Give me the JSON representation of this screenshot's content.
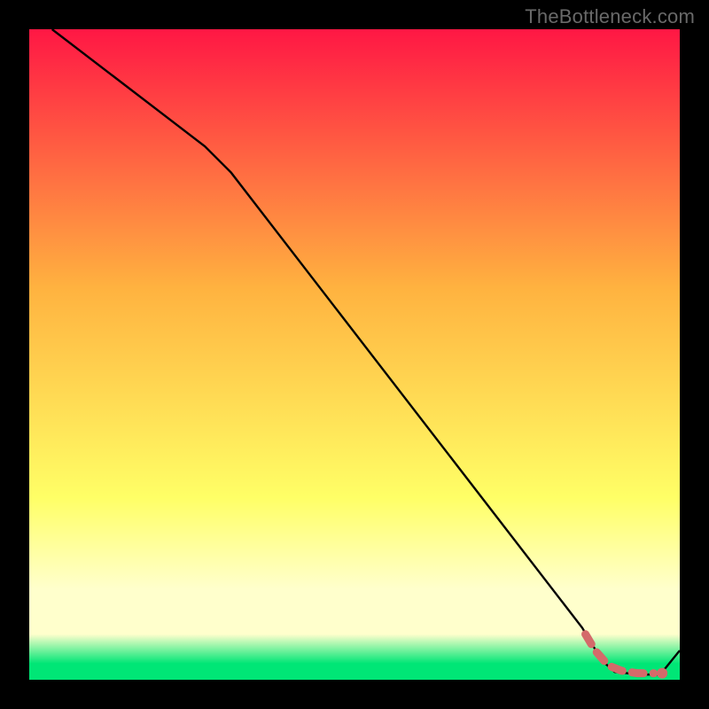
{
  "watermark": "TheBottleneck.com",
  "colors": {
    "top": "#ff1744",
    "mid_orange": "#ffb340",
    "yellow": "#ffff66",
    "pale_yellow": "#ffffcc",
    "green": "#00e676",
    "line": "#000000",
    "dash": "#d46a6a",
    "dot": "#d46a6a"
  },
  "chart_data": {
    "type": "line",
    "title": "",
    "xlabel": "",
    "ylabel": "",
    "xlim": [
      0,
      100
    ],
    "ylim": [
      0,
      100
    ],
    "grid": false,
    "series": [
      {
        "name": "curve",
        "style": "solid-black",
        "points": [
          {
            "x": 3.5,
            "y": 100
          },
          {
            "x": 27,
            "y": 82
          },
          {
            "x": 31,
            "y": 78
          },
          {
            "x": 85,
            "y": 8
          },
          {
            "x": 88,
            "y": 3
          },
          {
            "x": 90,
            "y": 1.2
          },
          {
            "x": 94,
            "y": 0.8
          },
          {
            "x": 97,
            "y": 0.8
          },
          {
            "x": 100,
            "y": 4.5
          }
        ]
      },
      {
        "name": "highlight-dash",
        "style": "dashed-red-thick",
        "points": [
          {
            "x": 85.5,
            "y": 7
          },
          {
            "x": 87,
            "y": 4.5
          },
          {
            "x": 89,
            "y": 2.2
          },
          {
            "x": 91,
            "y": 1.4
          },
          {
            "x": 93.5,
            "y": 1.0
          },
          {
            "x": 96,
            "y": 1.0
          }
        ]
      },
      {
        "name": "highlight-dot",
        "style": "dot-red",
        "points": [
          {
            "x": 97.3,
            "y": 1.0
          }
        ]
      }
    ]
  }
}
